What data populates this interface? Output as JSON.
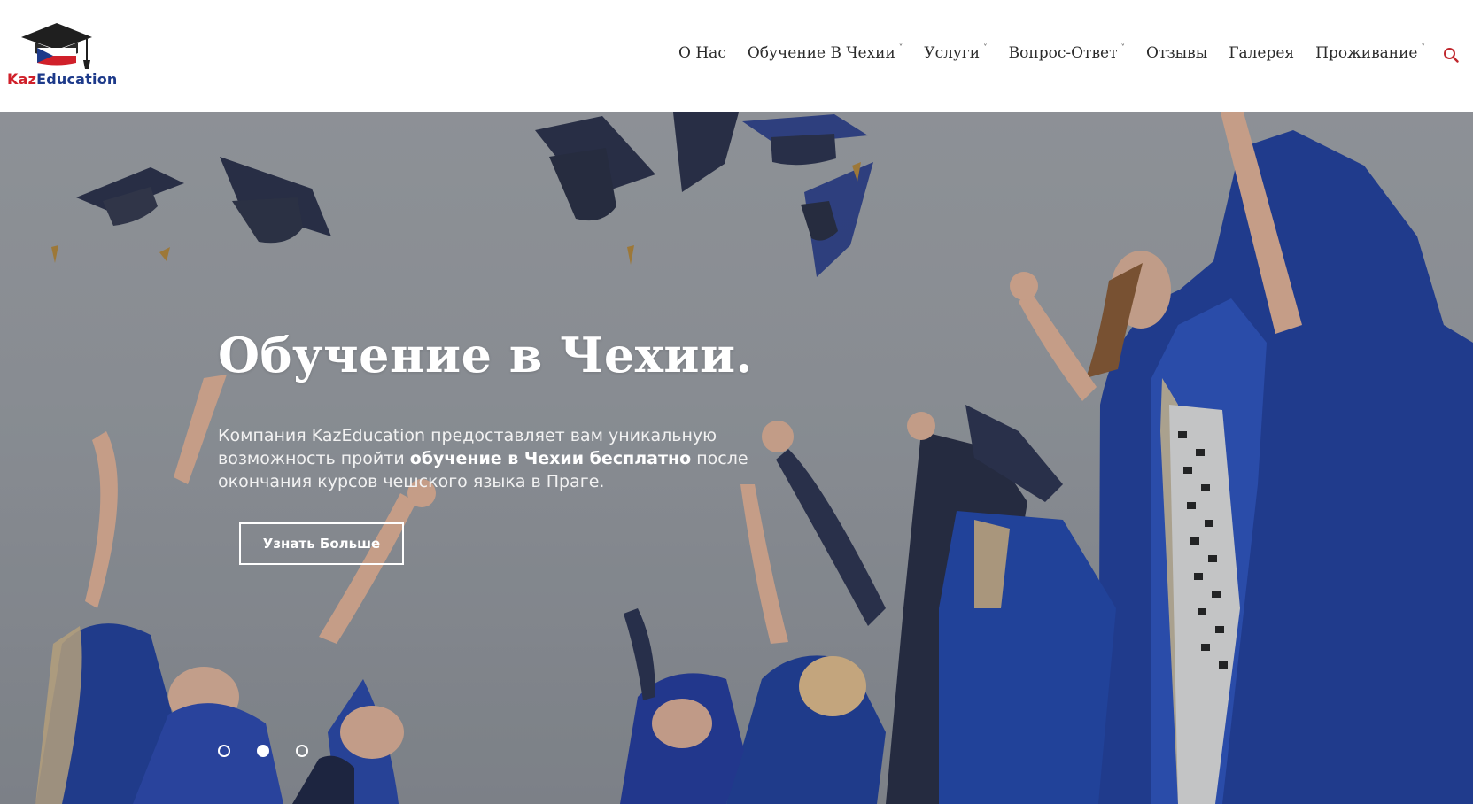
{
  "logo": {
    "kaz": "Kaz",
    "education": "Education"
  },
  "nav": {
    "items": [
      {
        "label": "О Нас",
        "has_dropdown": false
      },
      {
        "label": "Обучение В Чехии",
        "has_dropdown": true
      },
      {
        "label": "Услуги",
        "has_dropdown": true
      },
      {
        "label": "Вопрос-Ответ",
        "has_dropdown": true
      },
      {
        "label": "Отзывы",
        "has_dropdown": false
      },
      {
        "label": "Галерея",
        "has_dropdown": false
      },
      {
        "label": "Проживание",
        "has_dropdown": true
      }
    ],
    "dropdown_icon": "chevron-down-icon",
    "search_icon": "search-icon",
    "accent_color": "#c0272d"
  },
  "hero": {
    "title": "Обучение в Чехии.",
    "text_before": "Компания KazEducation предоставляет вам уникальную возможность пройти ",
    "text_bold": "обучение в Чехии бесплатно",
    "text_after": " после окончания курсов чешского языка в Праге.",
    "button_label": "Узнать Больше",
    "slides": {
      "total": 3,
      "active_index": 2
    }
  }
}
